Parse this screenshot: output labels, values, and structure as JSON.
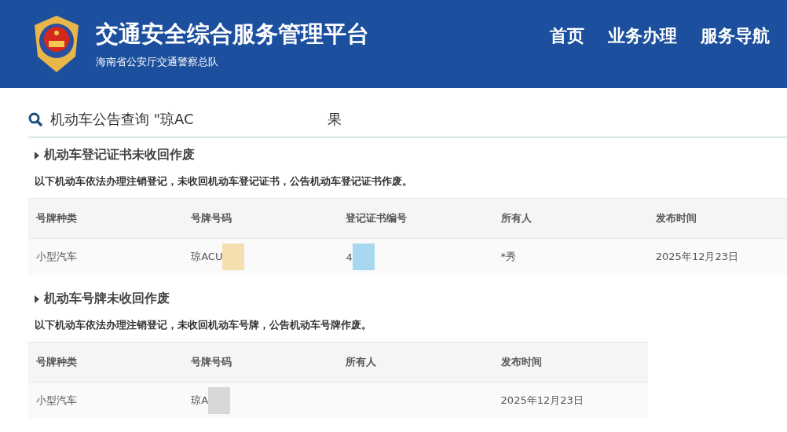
{
  "header": {
    "title": "交通安全综合服务管理平台",
    "subtitle": "海南省公安厅交通警察总队",
    "nav": [
      {
        "label": "首页",
        "selected": false
      },
      {
        "label": "业务办理",
        "selected": false
      },
      {
        "label": "服务导航",
        "selected": false
      }
    ]
  },
  "search_heading": {
    "before": "机动车公告查询 \"琼AC",
    "after": "果"
  },
  "sections": [
    {
      "title": "机动车登记证书未收回作废",
      "description": "以下机动车依法办理注销登记，未收回机动车登记证书，公告机动车登记证书作废。",
      "columns": [
        "号牌种类",
        "号牌号码",
        "登记证书编号",
        "所有人",
        "发布时间"
      ],
      "rows": [
        [
          {
            "text": "小型汽车"
          },
          {
            "text": "琼ACU",
            "redacted": true
          },
          {
            "text": "4",
            "redacted": true
          },
          {
            "text": "*秀"
          },
          {
            "text": "2025年12月23日"
          }
        ]
      ]
    },
    {
      "title": "机动车号牌未收回作废",
      "description": "以下机动车依法办理注销登记，未收回机动车号牌，公告机动车号牌作废。",
      "columns": [
        "号牌种类",
        "号牌号码",
        "所有人",
        "发布时间"
      ],
      "rows": [
        [
          {
            "text": "小型汽车"
          },
          {
            "text": "琼A",
            "redacted": true
          },
          null,
          {
            "text": "2025年12月23日"
          }
        ]
      ]
    }
  ]
}
